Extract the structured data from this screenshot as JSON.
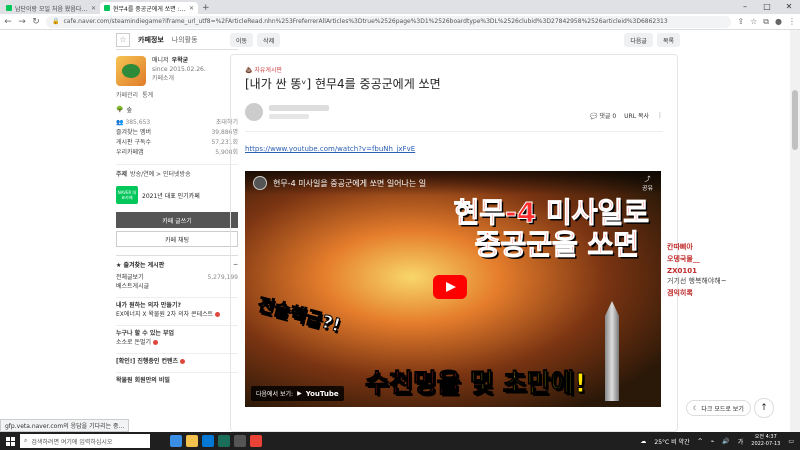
{
  "browser": {
    "tabs": [
      {
        "title": "남단이랑 모일 처음 왔음다는 이"
      },
      {
        "title": "현무4를 중공군에게 쏘면 : 네이"
      }
    ],
    "new_tab": "+",
    "url": "cafe.naver.com/steamindiegame?iframe_url_utf8=%2FArticleRead.nhn%253FreferrerAllArticles%3Dtrue%2526page%3D1%2526boardtype%3DL%2526clubid%3D27842958%2526articleid%3D6862313"
  },
  "sidebar": {
    "tab_info": "카페정보",
    "tab_activity": "나의활동",
    "manager_label": "매니저",
    "manager_name": "우왁굳",
    "since": "since 2015.02.26.",
    "cafe_intro": "카페소개",
    "manage": "카페관리",
    "stats": "통계",
    "grade": "숲",
    "members": "385,653",
    "invite": "초대하기",
    "fav_members_label": "즐겨찾는 멤버",
    "fav_members_val": "39,886명",
    "board_subs_label": "게시판 구독수",
    "board_subs_val": "57,231회",
    "cafe_chat_label": "우리카페앱",
    "cafe_chat_val": "5,908회",
    "theme_label": "주제",
    "theme_value": "방송/연예 > 인터넷방송",
    "naver_badge": "NAVER 대표카페",
    "naver_year": "2021년 대표 인기카페",
    "write_button": "카페 글쓰기",
    "chat_button": "카페 채팅",
    "fav_boards_title": "즐겨찾는 게시판",
    "boards": [
      {
        "name": "전체글보기",
        "count": "5,279,199"
      },
      {
        "name": "베스트게시글",
        "count": ""
      }
    ],
    "section1_title": "내가 원하는 의자 만들기?",
    "section1_item": "EX에너지 X 왁물원 2차 의자 콘테스트",
    "section2_title": "누구나 할 수 있는 부업",
    "section2_item": "소소로 돈벌기",
    "section3_title": "[확인!] 진행중인 컨텐츠",
    "section4_title": "왁물원 회원만의 비밀"
  },
  "toolbar": {
    "prev": "이동",
    "delete": "삭제",
    "next": "다음글",
    "list": "목록"
  },
  "article": {
    "category": "자유게시판",
    "title": "[내가 싼 똥ᵛ] 현무4를 중공군에게 쏘면",
    "comments": "댓글 0",
    "copy_url": "URL 복사",
    "link": "https://www.youtube.com/watch?v=fbuNh_jxFvE",
    "video_title": "현무-4 미사일을 중공군에게 쏘면 일어나는 일",
    "video_share": "공유",
    "watch_on": "다음에서 보기:",
    "youtube": "YouTube",
    "overlay_line1": "현무-4 미사일로",
    "overlay_line2": "중공군을 쏘면",
    "overlay_line3": "전술핵급?!",
    "overlay_line4a": "수천명을",
    "overlay_line4b": "몇 초만에!"
  },
  "chat": [
    {
      "name": "칸따삐아",
      "msg": ""
    },
    {
      "name": "오뎅국물__",
      "msg": ""
    },
    {
      "name": "ZX0101",
      "msg": "거기선 행복해야해~"
    },
    {
      "name": "겜익히록",
      "msg": ""
    }
  ],
  "dark_mode": "다크 모드로 보기",
  "status_text": "gfp.veta.naver.com의 응답을 기다리는 중...",
  "taskbar": {
    "search_placeholder": "검색하려면 여기에 입력하십시오",
    "weather": "25°C 비 약간",
    "time": "오전 4:37",
    "date": "2022-07-13"
  }
}
